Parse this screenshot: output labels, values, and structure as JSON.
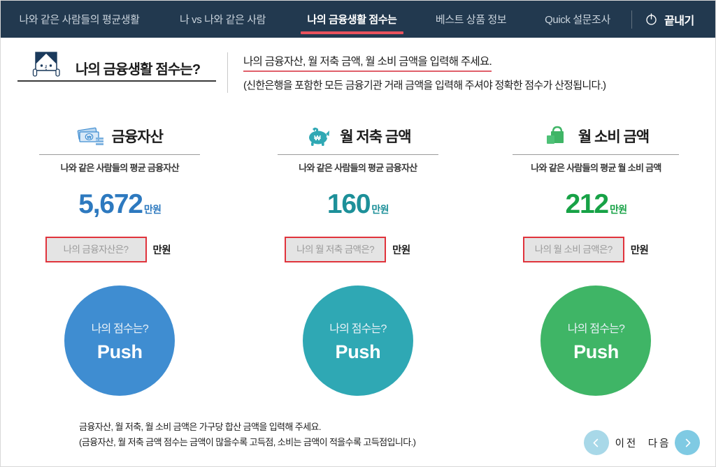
{
  "nav": {
    "tabs": [
      {
        "label": "나와 같은 사람들의 평균생활",
        "active": false
      },
      {
        "label": "나 vs 나와 같은 사람",
        "active": false
      },
      {
        "label": "나의 금융생활 점수는",
        "active": true
      },
      {
        "label": "베스트 상품 정보",
        "active": false
      },
      {
        "label": "Quick 설문조사",
        "active": false
      }
    ],
    "exit_label": "끝내기",
    "exit_icon": "power-icon",
    "active_underline_color": "#e8525d",
    "background_color": "#22394f"
  },
  "header": {
    "logo_icon": "face-peeking-icon",
    "title": "나의 금융생활 점수는?",
    "desc_main": "나의 금융자산, 월 저축 금액, 월 소비 금액을 입력해 주세요.",
    "desc_sub": "(신한은행을 포함한 모든 금융기관 거래 금액을 입력해 주셔야 정확한 점수가 산정됩니다.)",
    "desc_underline_color": "#e0606a"
  },
  "columns": [
    {
      "icon": "banknotes-icon",
      "title": "금융자산",
      "avg_label": "나와 같은 사람들의 평균 금융자산",
      "avg_number": "5,672",
      "avg_unit": "만원",
      "accent_color": "#2d79bf",
      "input_value": "",
      "input_placeholder": "나의 금융자산은?",
      "input_unit": "만원",
      "push_question": "나의 점수는?",
      "push_label": "Push",
      "push_color": "#3f8dd1"
    },
    {
      "icon": "piggy-bank-icon",
      "title": "월 저축 금액",
      "avg_label": "나와 같은 사람들의 평균 금융자산",
      "avg_number": "160",
      "avg_unit": "만원",
      "accent_color": "#1d9099",
      "input_value": "",
      "input_placeholder": "나의 월 저축 금액은?",
      "input_unit": "만원",
      "push_question": "나의 점수는?",
      "push_label": "Push",
      "push_color": "#2fa8b4"
    },
    {
      "icon": "shopping-bag-icon",
      "title": "월 소비 금액",
      "avg_label": "나와 같은 사람들의 평균 월 소비 금액",
      "avg_number": "212",
      "avg_unit": "만원",
      "accent_color": "#17a246",
      "input_value": "",
      "input_placeholder": "나의 월 소비 금액은?",
      "input_unit": "만원",
      "push_question": "나의 점수는?",
      "push_label": "Push",
      "push_color": "#3fb566"
    }
  ],
  "footer": {
    "note_line1": "금융자산, 월 저축, 월 소비 금액은 가구당 합산 금액을 입력해 주세요.",
    "note_line2": "(금융자산, 월 저축 금액 점수는 금액이 많을수록 고득점, 소비는 금액이 적을수록 고득점입니다.)"
  },
  "pager": {
    "prev_label": "이 전",
    "next_label": "다 음",
    "prev_icon": "chevron-left-icon",
    "next_icon": "chevron-right-icon"
  }
}
